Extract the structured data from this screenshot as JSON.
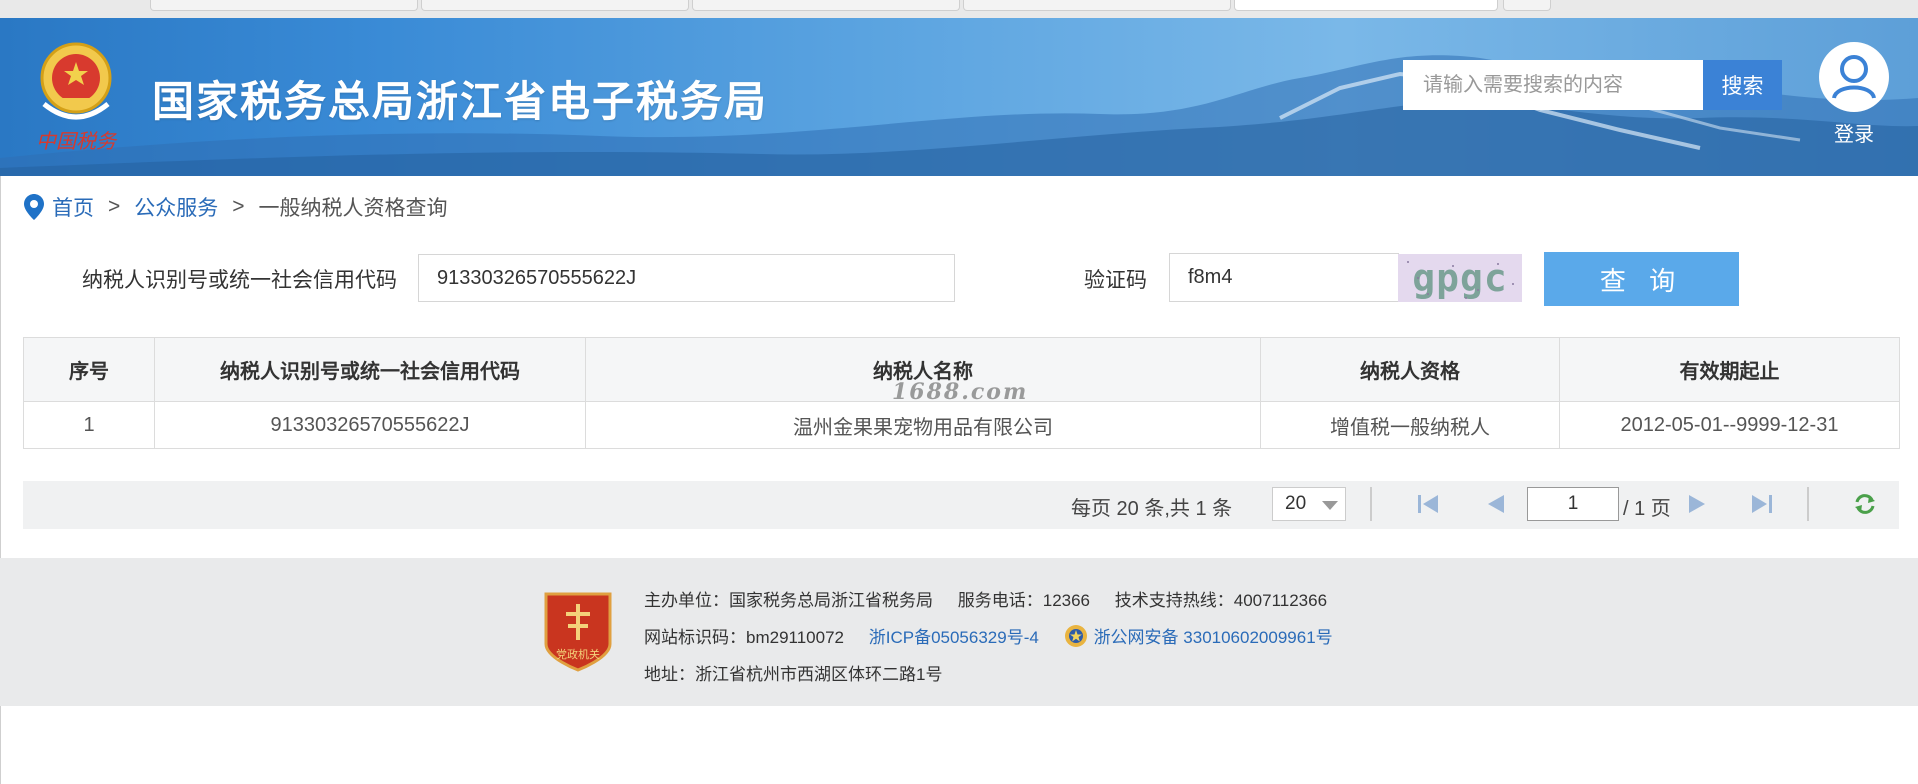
{
  "header": {
    "title": "国家税务总局浙江省电子税务局",
    "emblem_text": "中国税务",
    "search_placeholder": "请输入需要搜索的内容",
    "search_button": "搜索",
    "login_label": "登录"
  },
  "breadcrumb": {
    "home": "首页",
    "separator": ">",
    "section": "公众服务",
    "current": "一般纳税人资格查询"
  },
  "query": {
    "taxpayer_id_label": "纳税人识别号或统一社会信用代码",
    "taxpayer_id_value": "91330326570555622J",
    "captcha_label": "验证码",
    "captcha_value": "f8m4",
    "captcha_image_text": "gpgc",
    "query_button": "查 询"
  },
  "table": {
    "columns": [
      "序号",
      "纳税人识别号或统一社会信用代码",
      "纳税人名称",
      "纳税人资格",
      "有效期起止"
    ],
    "rows": [
      [
        "1",
        "91330326570555622J",
        "温州金果果宠物用品有限公司",
        "增值税一般纳税人",
        "2012-05-01--9999-12-31"
      ]
    ]
  },
  "watermark": "1688.com",
  "pagination": {
    "info": "每页 20 条,共 1 条",
    "page_size": "20",
    "current_page": "1",
    "total_pages": "/ 1 页"
  },
  "footer": {
    "sponsor": "主办单位：国家税务总局浙江省税务局",
    "phone": "服务电话：12366",
    "support": "技术支持热线：4007112366",
    "site_id": "网站标识码：bm29110072",
    "icp": "浙ICP备05056329号-4",
    "police": "浙公网安备 33010602009961号",
    "address": "地址：浙江省杭州市西湖区体环二路1号",
    "badge_text": "党政机关"
  },
  "colors": {
    "header_blue": "#3a8bd6",
    "search_button": "#3b82d6",
    "query_button": "#5aa9ea",
    "link": "#2a6bb8",
    "footer_bg": "#e9eaeb"
  }
}
